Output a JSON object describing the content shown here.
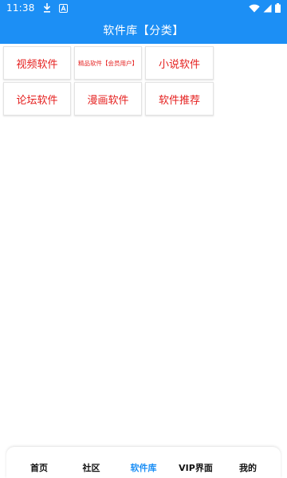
{
  "status_bar": {
    "time": "11:38",
    "icons": [
      "download-icon",
      "a-badge-icon",
      "wifi-icon",
      "signal-icon",
      "battery-icon"
    ]
  },
  "app_bar": {
    "title": "软件库【分类】"
  },
  "categories": [
    {
      "label": "视频软件"
    },
    {
      "label": "精品软件【会员用户】"
    },
    {
      "label": "小说软件"
    },
    {
      "label": "论坛软件"
    },
    {
      "label": "漫画软件"
    },
    {
      "label": "软件推荐"
    }
  ],
  "bottom_nav": {
    "items": [
      {
        "label": "首页"
      },
      {
        "label": "社区"
      },
      {
        "label": "软件库"
      },
      {
        "label": "VIP界面"
      },
      {
        "label": "我的"
      }
    ],
    "active_index": 2
  },
  "colors": {
    "accent": "#1c8ff5",
    "tile_text": "#e5201f"
  }
}
